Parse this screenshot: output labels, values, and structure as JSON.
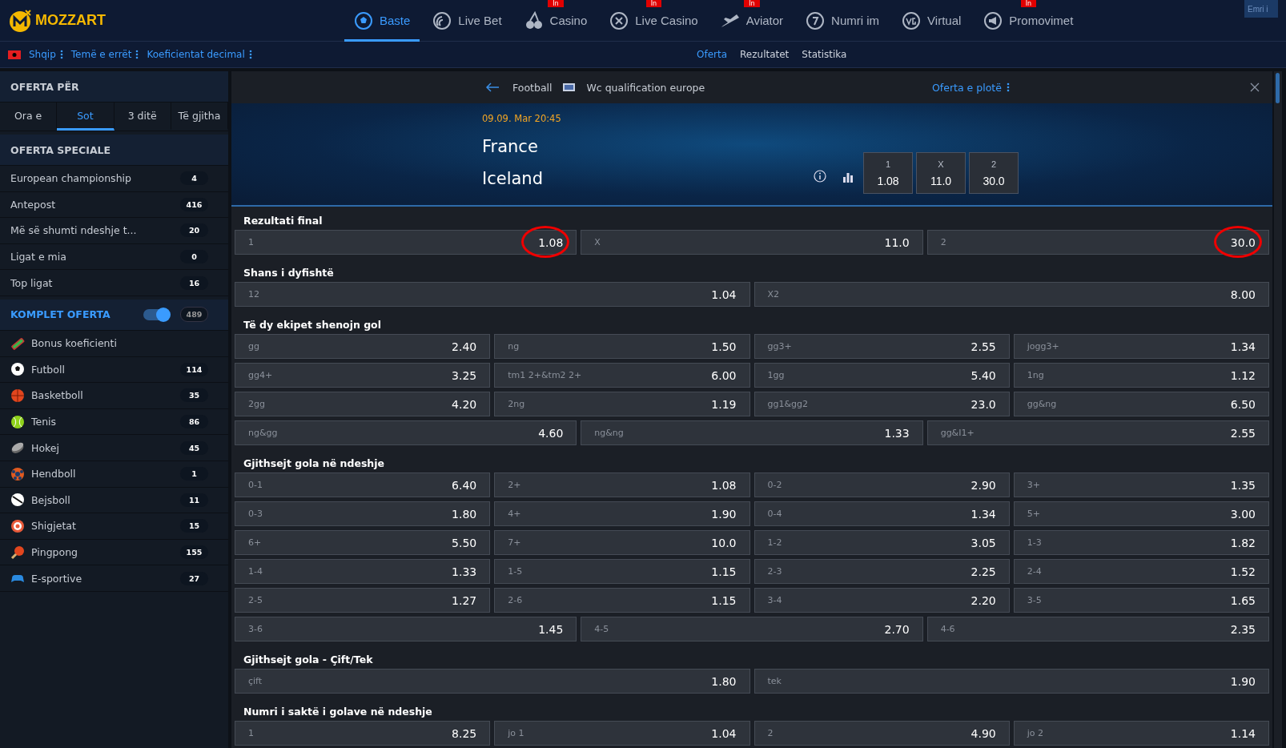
{
  "brand": {
    "name": "MOZZART"
  },
  "nav": [
    {
      "label": "Baste",
      "kind": "ball",
      "selected": true
    },
    {
      "label": "Live Bet",
      "kind": "live",
      "selected": false
    },
    {
      "label": "Casino",
      "kind": "cherry",
      "selected": false,
      "badge": "In"
    },
    {
      "label": "Live Casino",
      "kind": "cross",
      "selected": false,
      "badge": "In"
    },
    {
      "label": "Aviator",
      "kind": "plane",
      "selected": false,
      "badge": "In"
    },
    {
      "label": "Numri im",
      "kind": "seven",
      "selected": false
    },
    {
      "label": "Virtual",
      "kind": "vg",
      "selected": false
    },
    {
      "label": "Promovimet",
      "kind": "horn",
      "selected": false,
      "badge": "In"
    }
  ],
  "login_field": {
    "placeholder": "Emri i"
  },
  "settings": [
    "Shqip",
    "Temë e errët",
    "Koeficientat decimal"
  ],
  "subnav": [
    {
      "label": "Oferta",
      "selected": true
    },
    {
      "label": "Rezultatet",
      "selected": false
    },
    {
      "label": "Statistika",
      "selected": false
    }
  ],
  "sidebar": {
    "title": "OFERTA PËR",
    "tabs": [
      {
        "label": "Ora e",
        "selected": false
      },
      {
        "label": "Sot",
        "selected": true
      },
      {
        "label": "3 ditë",
        "selected": false
      },
      {
        "label": "Të gjitha",
        "selected": false
      }
    ],
    "special_title": "OFERTA SPECIALE",
    "special": [
      {
        "label": "European championship",
        "count": "4"
      },
      {
        "label": "Antepost",
        "count": "416"
      },
      {
        "label": "Më së shumti ndeshje t...",
        "count": "20"
      },
      {
        "label": "Ligat e mia",
        "count": "0"
      },
      {
        "label": "Top ligat",
        "count": "16"
      }
    ],
    "full_title": "KOMPLET OFERTA",
    "full_on": true,
    "full_count": "489",
    "sports": [
      {
        "label": "Bonus koeficienti",
        "kind": "bonus"
      },
      {
        "label": "Futboll",
        "kind": "football",
        "count": "114"
      },
      {
        "label": "Basketboll",
        "kind": "basketball",
        "count": "35"
      },
      {
        "label": "Tenis",
        "kind": "tennis",
        "count": "86"
      },
      {
        "label": "Hokej",
        "kind": "hockey",
        "count": "45"
      },
      {
        "label": "Hendboll",
        "kind": "handball",
        "count": "1"
      },
      {
        "label": "Bejsboll",
        "kind": "baseball",
        "count": "11"
      },
      {
        "label": "Shigjetat",
        "kind": "darts",
        "count": "15"
      },
      {
        "label": "Pingpong",
        "kind": "pingpong",
        "count": "155"
      },
      {
        "label": "E-sportive",
        "kind": "esports",
        "count": "27"
      }
    ]
  },
  "match": {
    "sport": "Football",
    "league": "Wc qualification europe",
    "full_offer": "Oferta e plotë",
    "datetime": "09.09. Mar 20:45",
    "home": "France",
    "away": "Iceland",
    "odds": [
      {
        "label": "1",
        "value": "1.08"
      },
      {
        "label": "X",
        "value": "11.0"
      },
      {
        "label": "2",
        "value": "30.0"
      }
    ]
  },
  "markets": [
    {
      "title": "Rezultati final",
      "rows": [
        [
          {
            "label": "1",
            "odd": "1.08",
            "circled": true
          },
          {
            "label": "X",
            "odd": "11.0",
            "circled": false
          },
          {
            "label": "2",
            "odd": "30.0",
            "circled": true
          }
        ]
      ]
    },
    {
      "title": "Shans i dyfishtë",
      "rows": [
        [
          {
            "label": "12",
            "odd": "1.04",
            "circled": false
          },
          {
            "label": "X2",
            "odd": "8.00",
            "circled": false
          }
        ]
      ]
    },
    {
      "title": "Të dy ekipet shenojn gol",
      "rows": [
        [
          {
            "label": "gg",
            "odd": "2.40",
            "circled": false
          },
          {
            "label": "ng",
            "odd": "1.50",
            "circled": false
          },
          {
            "label": "gg3+",
            "odd": "2.55",
            "circled": false
          },
          {
            "label": "jogg3+",
            "odd": "1.34",
            "circled": false
          }
        ],
        [
          {
            "label": "gg4+",
            "odd": "3.25",
            "circled": false
          },
          {
            "label": "tm1 2+&tm2 2+",
            "odd": "6.00",
            "circled": false
          },
          {
            "label": "1gg",
            "odd": "5.40",
            "circled": false
          },
          {
            "label": "1ng",
            "odd": "1.12",
            "circled": false
          }
        ],
        [
          {
            "label": "2gg",
            "odd": "4.20",
            "circled": false
          },
          {
            "label": "2ng",
            "odd": "1.19",
            "circled": false
          },
          {
            "label": "gg1&gg2",
            "odd": "23.0",
            "circled": false
          },
          {
            "label": "gg&ng",
            "odd": "6.50",
            "circled": false
          }
        ],
        [
          {
            "label": "ng&gg",
            "odd": "4.60",
            "circled": false
          },
          {
            "label": "ng&ng",
            "odd": "1.33",
            "circled": false
          },
          {
            "label": "gg&I1+",
            "odd": "2.55",
            "circled": false
          }
        ]
      ]
    },
    {
      "title": "Gjithsejt gola në ndeshje",
      "rows": [
        [
          {
            "label": "0-1",
            "odd": "6.40",
            "circled": false
          },
          {
            "label": "2+",
            "odd": "1.08",
            "circled": false
          },
          {
            "label": "0-2",
            "odd": "2.90",
            "circled": false
          },
          {
            "label": "3+",
            "odd": "1.35",
            "circled": false
          }
        ],
        [
          {
            "label": "0-3",
            "odd": "1.80",
            "circled": false
          },
          {
            "label": "4+",
            "odd": "1.90",
            "circled": false
          },
          {
            "label": "0-4",
            "odd": "1.34",
            "circled": false
          },
          {
            "label": "5+",
            "odd": "3.00",
            "circled": false
          }
        ],
        [
          {
            "label": "6+",
            "odd": "5.50",
            "circled": false
          },
          {
            "label": "7+",
            "odd": "10.0",
            "circled": false
          },
          {
            "label": "1-2",
            "odd": "3.05",
            "circled": false
          },
          {
            "label": "1-3",
            "odd": "1.82",
            "circled": false
          }
        ],
        [
          {
            "label": "1-4",
            "odd": "1.33",
            "circled": false
          },
          {
            "label": "1-5",
            "odd": "1.15",
            "circled": false
          },
          {
            "label": "2-3",
            "odd": "2.25",
            "circled": false
          },
          {
            "label": "2-4",
            "odd": "1.52",
            "circled": false
          }
        ],
        [
          {
            "label": "2-5",
            "odd": "1.27",
            "circled": false
          },
          {
            "label": "2-6",
            "odd": "1.15",
            "circled": false
          },
          {
            "label": "3-4",
            "odd": "2.20",
            "circled": false
          },
          {
            "label": "3-5",
            "odd": "1.65",
            "circled": false
          }
        ],
        [
          {
            "label": "3-6",
            "odd": "1.45",
            "circled": false
          },
          {
            "label": "4-5",
            "odd": "2.70",
            "circled": false
          },
          {
            "label": "4-6",
            "odd": "2.35",
            "circled": false
          }
        ]
      ]
    },
    {
      "title": "Gjithsejt gola - Çift/Tek",
      "rows": [
        [
          {
            "label": "çift",
            "odd": "1.80",
            "circled": false
          },
          {
            "label": "tek",
            "odd": "1.90",
            "circled": false
          }
        ]
      ]
    },
    {
      "title": "Numri i saktë i golave në ndeshje",
      "rows": [
        [
          {
            "label": "1",
            "odd": "8.25",
            "circled": false
          },
          {
            "label": "jo 1",
            "odd": "1.04",
            "circled": false
          },
          {
            "label": "2",
            "odd": "4.90",
            "circled": false
          },
          {
            "label": "jo 2",
            "odd": "1.14",
            "circled": false
          }
        ]
      ]
    }
  ]
}
